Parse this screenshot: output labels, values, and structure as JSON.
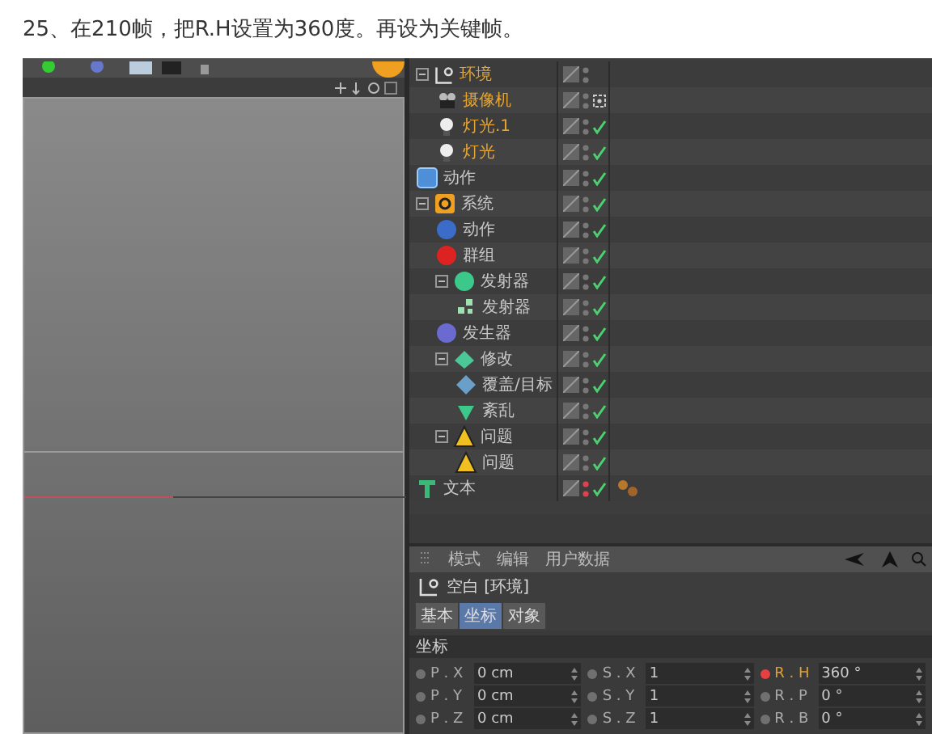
{
  "caption": "25、在210帧，把R.H设置为360度。再设为关键帧。",
  "objects": [
    {
      "name": "环境",
      "kind": "null",
      "selected": true,
      "expanded": true,
      "enabled": false,
      "protected": false,
      "hidden": false,
      "tag": false,
      "children": [
        {
          "name": "摄像机",
          "kind": "camera",
          "selected": true,
          "enabled": false,
          "protected": true,
          "hidden": false,
          "tag": false
        },
        {
          "name": "灯光.1",
          "kind": "light",
          "selected": true,
          "enabled": true,
          "protected": false,
          "hidden": false,
          "tag": false
        },
        {
          "name": "灯光",
          "kind": "light",
          "selected": true,
          "enabled": true,
          "protected": false,
          "hidden": false,
          "tag": false
        }
      ]
    },
    {
      "name": "动作",
      "kind": "motion",
      "selected": false,
      "enabled": true,
      "protected": false,
      "hidden": false,
      "tag": false
    },
    {
      "name": "系统",
      "kind": "system",
      "selected": false,
      "expanded": true,
      "enabled": true,
      "protected": false,
      "hidden": false,
      "tag": false,
      "children": [
        {
          "name": "动作",
          "kind": "action",
          "selected": false,
          "enabled": true,
          "protected": false,
          "hidden": false,
          "tag": false
        },
        {
          "name": "群组",
          "kind": "group",
          "selected": false,
          "enabled": true,
          "protected": false,
          "hidden": false,
          "tag": false
        },
        {
          "name": "发射器",
          "kind": "emitters",
          "selected": false,
          "expanded": true,
          "enabled": true,
          "protected": false,
          "hidden": false,
          "tag": false,
          "children": [
            {
              "name": "发射器",
              "kind": "emitter",
              "selected": false,
              "enabled": true,
              "protected": false,
              "hidden": false,
              "tag": false
            }
          ]
        },
        {
          "name": "发生器",
          "kind": "generator",
          "selected": false,
          "enabled": true,
          "protected": false,
          "hidden": false,
          "tag": false
        },
        {
          "name": "修改",
          "kind": "modifiers",
          "selected": false,
          "expanded": true,
          "enabled": true,
          "protected": false,
          "hidden": false,
          "tag": false,
          "children": [
            {
              "name": "覆盖/目标",
              "kind": "cover",
              "selected": false,
              "enabled": true,
              "protected": false,
              "hidden": false,
              "tag": false
            },
            {
              "name": "紊乱",
              "kind": "turbulence",
              "selected": false,
              "enabled": true,
              "protected": false,
              "hidden": false,
              "tag": false
            }
          ]
        },
        {
          "name": "问题",
          "kind": "questions",
          "selected": false,
          "expanded": true,
          "enabled": true,
          "protected": false,
          "hidden": false,
          "tag": false,
          "children": [
            {
              "name": "问题",
              "kind": "question",
              "selected": false,
              "enabled": true,
              "protected": false,
              "hidden": false,
              "tag": false
            }
          ]
        }
      ]
    },
    {
      "name": "文本",
      "kind": "text",
      "selected": false,
      "enabled": true,
      "protected": false,
      "hidden": true,
      "tag": true
    }
  ],
  "attributes": {
    "menu": [
      "模式",
      "编辑",
      "用户数据"
    ],
    "object_title": "空白 [环境]",
    "tabs": [
      {
        "label": "基本",
        "selected": false
      },
      {
        "label": "坐标",
        "selected": true
      },
      {
        "label": "对象",
        "selected": false
      }
    ],
    "section": "坐标",
    "fields": [
      {
        "label": "P . X",
        "value": "0 cm",
        "keyframe": false
      },
      {
        "label": "S . X",
        "value": "1",
        "keyframe": false
      },
      {
        "label": "R . H",
        "value": "360 °",
        "keyframe": true
      },
      {
        "label": "P . Y",
        "value": "0 cm",
        "keyframe": false
      },
      {
        "label": "S . Y",
        "value": "1",
        "keyframe": false
      },
      {
        "label": "R . P",
        "value": "0 °",
        "keyframe": false
      },
      {
        "label": "P . Z",
        "value": "0 cm",
        "keyframe": false
      },
      {
        "label": "S . Z",
        "value": "1",
        "keyframe": false
      },
      {
        "label": "R . B",
        "value": "0 °",
        "keyframe": false
      }
    ]
  }
}
